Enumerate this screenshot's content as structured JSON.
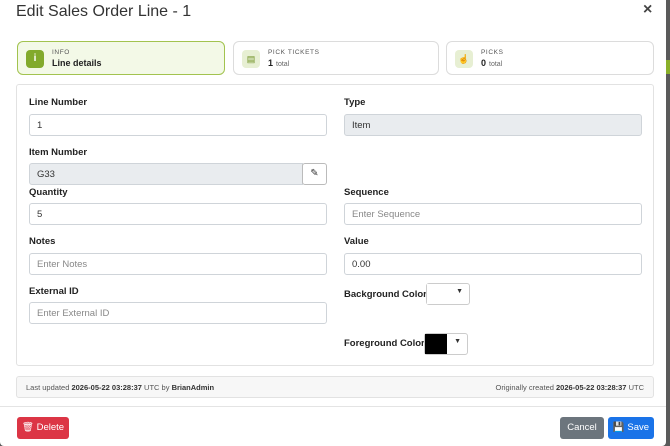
{
  "modal": {
    "title": "Edit Sales Order Line - 1",
    "close_icon": "×"
  },
  "tabs": [
    {
      "label": "INFO",
      "value": "Line details",
      "sub": "",
      "icon": "info-icon"
    },
    {
      "label": "PICK TICKETS",
      "value": "1",
      "sub": "total",
      "icon": "clipboard-icon"
    },
    {
      "label": "PICKS",
      "value": "0",
      "sub": "total",
      "icon": "hand-pointer-icon"
    }
  ],
  "fields": {
    "line_number": {
      "label": "Line Number",
      "value": "1"
    },
    "type": {
      "label": "Type",
      "value": "Item"
    },
    "item_number": {
      "label": "Item Number",
      "value": "G33"
    },
    "quantity": {
      "label": "Quantity",
      "value": "5"
    },
    "sequence": {
      "label": "Sequence",
      "placeholder": "Enter Sequence"
    },
    "notes": {
      "label": "Notes",
      "placeholder": "Enter Notes"
    },
    "value": {
      "label": "Value",
      "value": "0.00"
    },
    "external_id": {
      "label": "External ID",
      "placeholder": "Enter External ID"
    },
    "background_color": {
      "label": "Background Color",
      "color": "#ffffff"
    },
    "foreground_color": {
      "label": "Foreground Color",
      "color": "#000000"
    }
  },
  "footer": {
    "last_updated_prefix": "Last updated",
    "last_updated_ts": "2026-05-22 03:28:37",
    "last_updated_mid": "UTC by",
    "last_updated_user": "BrianAdmin",
    "created_prefix": "Originally created",
    "created_ts": "2026-05-22 03:28:37",
    "created_suffix": "UTC"
  },
  "buttons": {
    "delete": "Delete",
    "cancel": "Cancel",
    "save": "Save"
  },
  "colors": {
    "accent": "#82aa2c",
    "danger": "#dc3545",
    "primary": "#1a73e8",
    "secondary": "#6c757d"
  }
}
